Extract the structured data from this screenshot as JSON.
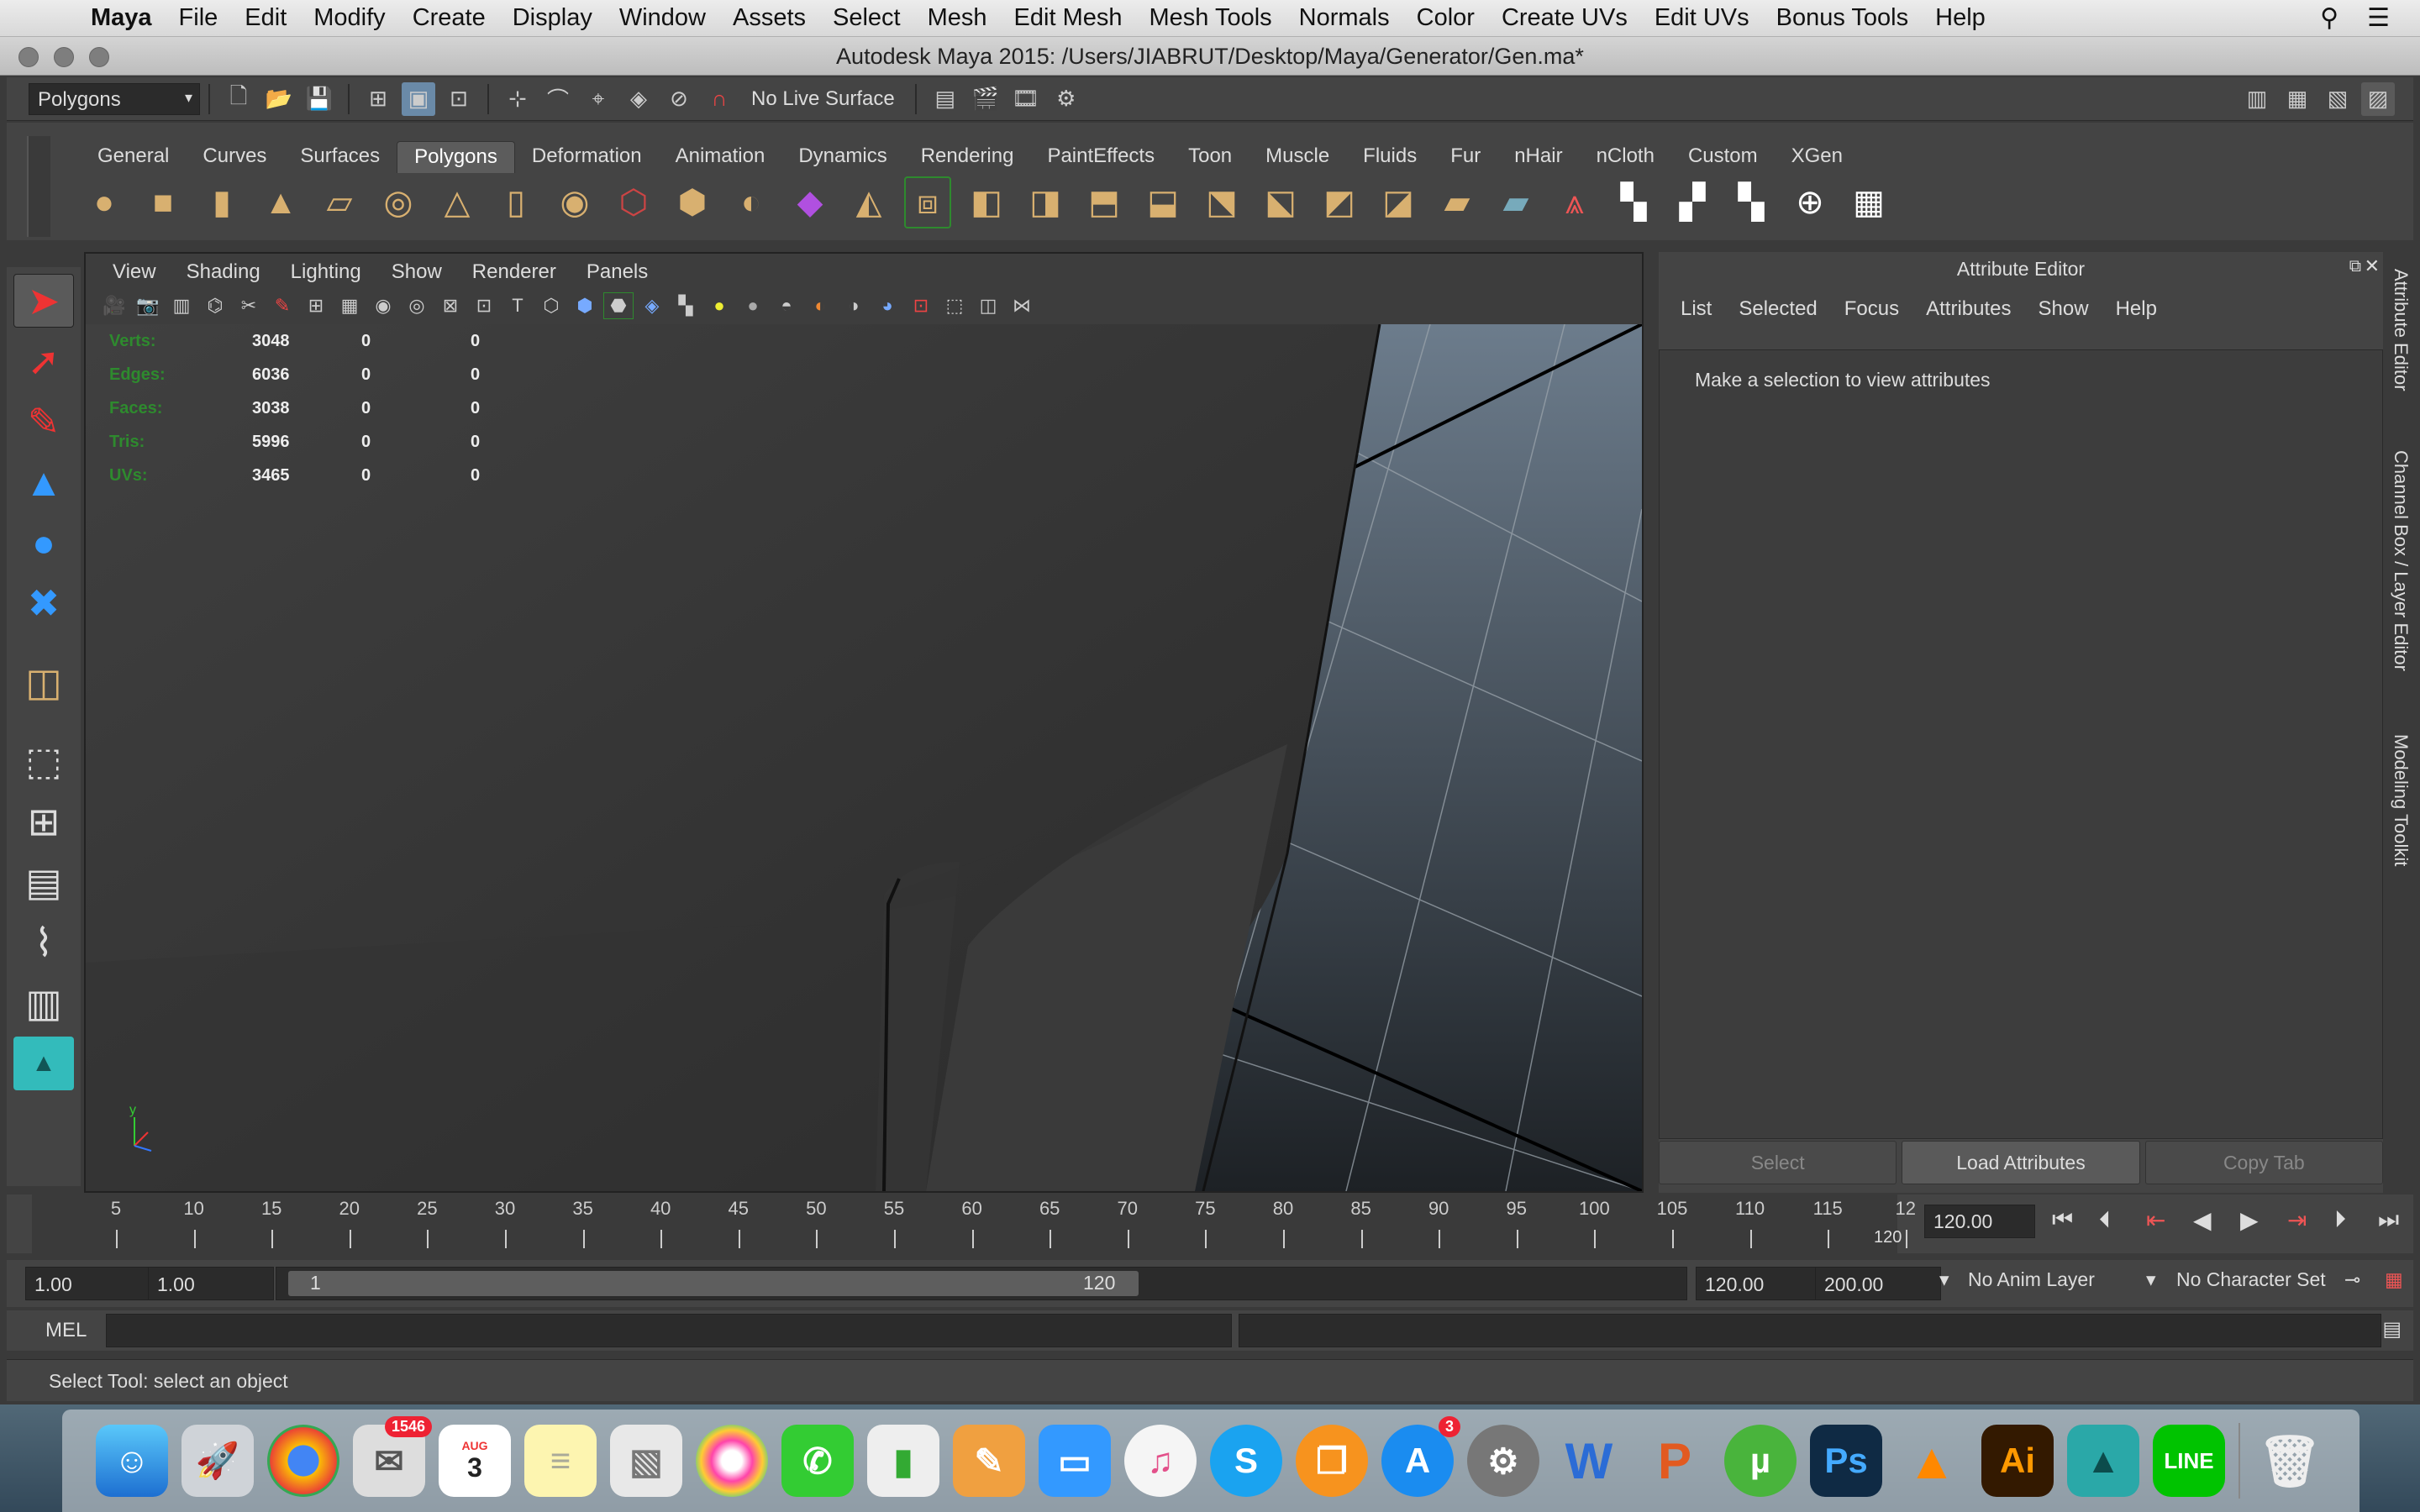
{
  "menubar": {
    "app": "Maya",
    "items": [
      "File",
      "Edit",
      "Modify",
      "Create",
      "Display",
      "Window",
      "Assets",
      "Select",
      "Mesh",
      "Edit Mesh",
      "Mesh Tools",
      "Normals",
      "Color",
      "Create UVs",
      "Edit UVs",
      "Bonus Tools",
      "Help"
    ]
  },
  "window": {
    "title": "Autodesk Maya 2015: /Users/JIABRUT/Desktop/Maya/Generator/Gen.ma*"
  },
  "status_line": {
    "mode": "Polygons",
    "live_surface": "No Live Surface"
  },
  "shelf": {
    "tabs": [
      "General",
      "Curves",
      "Surfaces",
      "Polygons",
      "Deformation",
      "Animation",
      "Dynamics",
      "Rendering",
      "PaintEffects",
      "Toon",
      "Muscle",
      "Fluids",
      "Fur",
      "nHair",
      "nCloth",
      "Custom",
      "XGen"
    ],
    "active_tab": "Polygons"
  },
  "panel": {
    "menu": [
      "View",
      "Shading",
      "Lighting",
      "Show",
      "Renderer",
      "Panels"
    ]
  },
  "hud": {
    "rows": [
      {
        "label": "Verts:",
        "v1": "3048",
        "v2": "0",
        "v3": "0"
      },
      {
        "label": "Edges:",
        "v1": "6036",
        "v2": "0",
        "v3": "0"
      },
      {
        "label": "Faces:",
        "v1": "3038",
        "v2": "0",
        "v3": "0"
      },
      {
        "label": "Tris:",
        "v1": "5996",
        "v2": "0",
        "v3": "0"
      },
      {
        "label": "UVs:",
        "v1": "3465",
        "v2": "0",
        "v3": "0"
      }
    ]
  },
  "attribute_editor": {
    "title": "Attribute Editor",
    "menu": [
      "List",
      "Selected",
      "Focus",
      "Attributes",
      "Show",
      "Help"
    ],
    "message": "Make a selection to view attributes",
    "buttons": {
      "select": "Select",
      "load": "Load Attributes",
      "copy": "Copy Tab"
    }
  },
  "side_tabs": [
    "Attribute Editor",
    "Channel Box / Layer Editor",
    "Modeling Toolkit"
  ],
  "timeline": {
    "ticks": [
      "5",
      "10",
      "15",
      "20",
      "25",
      "30",
      "35",
      "40",
      "45",
      "50",
      "55",
      "60",
      "65",
      "70",
      "75",
      "80",
      "85",
      "90",
      "95",
      "100",
      "105",
      "110",
      "115",
      "12"
    ],
    "end_label": "120",
    "current_frame": "120.00"
  },
  "range": {
    "start": "1.00",
    "start2": "1.00",
    "slider_start": "1",
    "slider_end": "120",
    "end": "120.00",
    "end2": "200.00",
    "anim_layer": "No Anim Layer",
    "char_set": "No Character Set"
  },
  "command_line": {
    "label": "MEL"
  },
  "help_line": {
    "text": "Select Tool: select an object"
  },
  "dock": {
    "mail_badge": "1546",
    "calendar_month": "AUG",
    "calendar_day": "3",
    "appstore_badge": "3"
  }
}
